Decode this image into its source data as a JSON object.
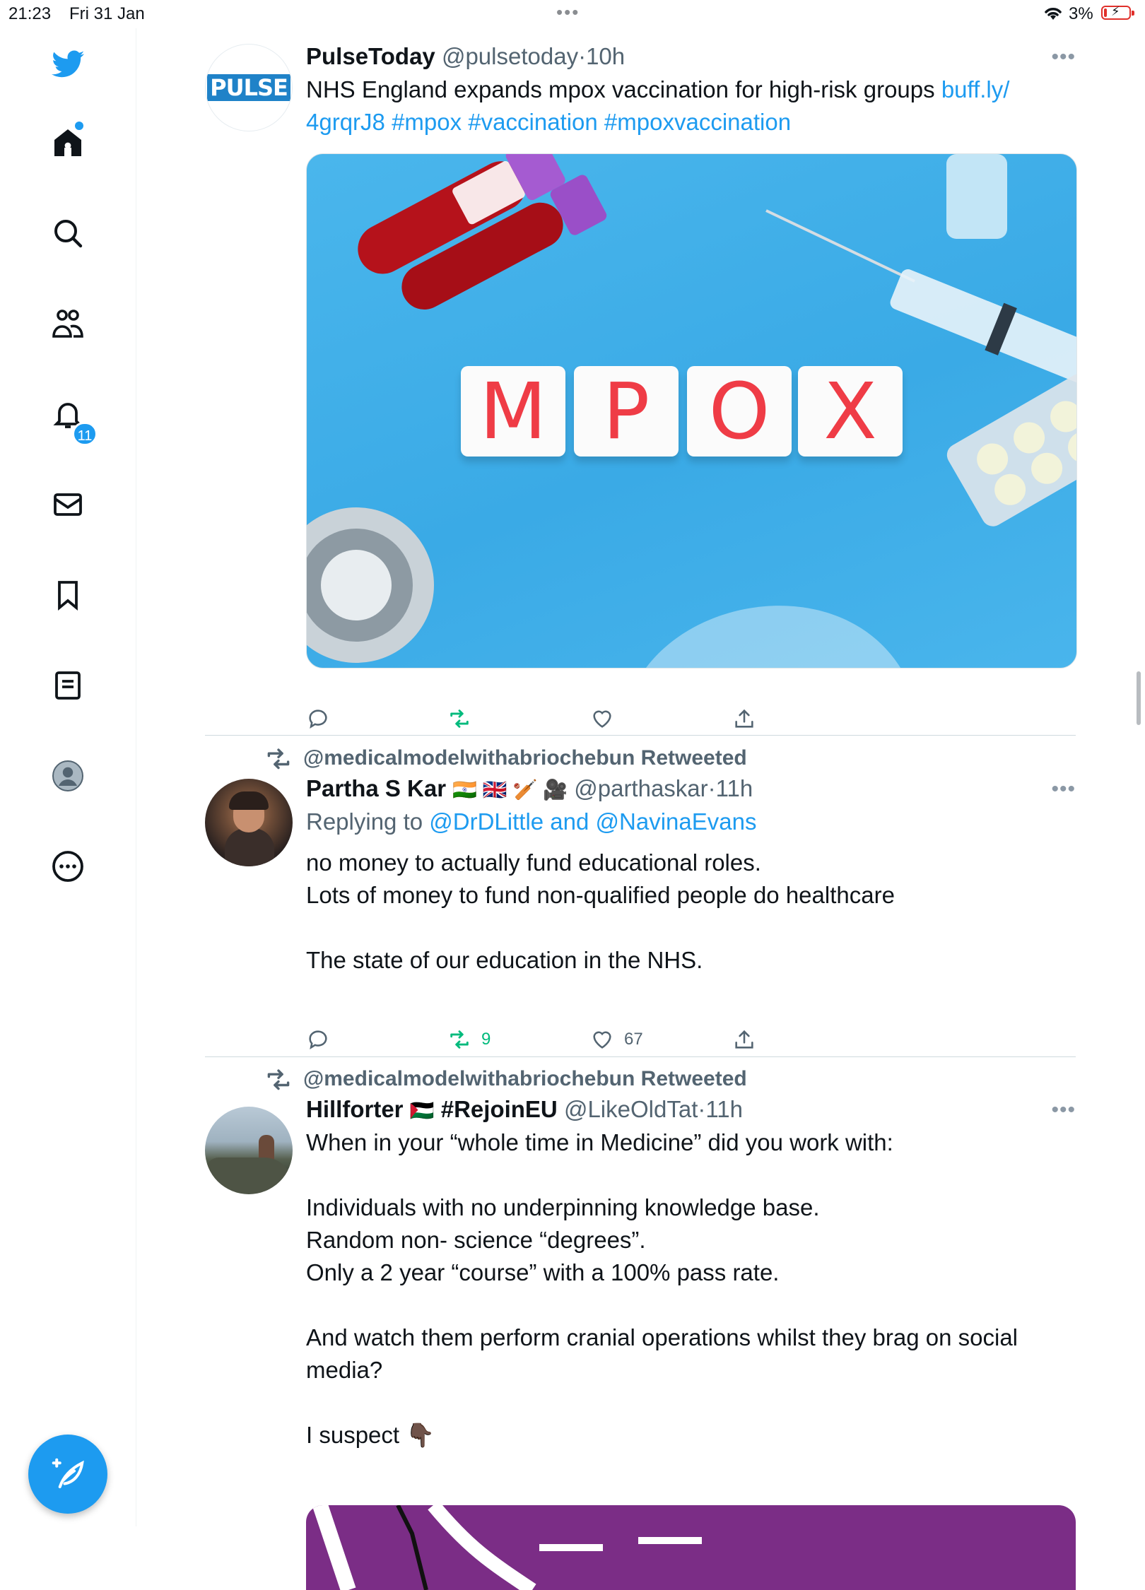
{
  "status_bar": {
    "time": "21:23",
    "date": "Fri 31 Jan",
    "battery": "3%"
  },
  "sidebar": {
    "items": [
      "twitter-logo",
      "home",
      "explore",
      "communities",
      "notifications",
      "messages",
      "bookmarks",
      "lists",
      "profile",
      "more"
    ],
    "notification_count": "11"
  },
  "tweets": [
    {
      "name": "PulseToday",
      "handle": "@pulsetoday",
      "sep": "·",
      "time": "10h",
      "avatar_text": "PULSE",
      "text": "NHS England expands mpox vaccination for high-risk groups ",
      "link_1": "buff.ly/",
      "link_2": "4grqrJ8",
      "hashtags": [
        "#mpox",
        "#vaccination",
        "#mpoxvaccination"
      ],
      "media_tiles": [
        "M",
        "P",
        "O",
        "X"
      ]
    },
    {
      "retweeted_by": "@medicalmodelwithabriochebun Retweeted",
      "name": "Partha S Kar",
      "name_emoji": "🇮🇳 🇬🇧 🏏 🎥",
      "handle": "@parthaskar",
      "sep": "·",
      "time": "11h",
      "replying_prefix": "Replying to ",
      "replying_to": "@DrDLittle and @NavinaEvans",
      "lines": [
        "no money to actually fund educational roles.",
        "Lots of money to fund non-qualified people do healthcare",
        "The state of our education in the NHS."
      ],
      "retweets": "9",
      "likes": "67"
    },
    {
      "retweeted_by": "@medicalmodelwithabriochebun Retweeted",
      "name": "Hillforter",
      "name_suffix": "#RejoinEU",
      "name_flag": "🇵🇸",
      "handle": "@LikeOldTat",
      "sep": "·",
      "time": "11h",
      "lines": [
        "When in your “whole time in Medicine” did you work with:",
        "Individuals with no underpinning knowledge base.",
        "Random non- science “degrees”.",
        "Only a 2 year “course” with a 100% pass rate.",
        "And watch them perform cranial operations whilst they brag on social",
        "media?",
        "I suspect 👇🏿"
      ]
    }
  ],
  "colors": {
    "accent": "#1d9bf0",
    "retweet_green": "#00ba7c",
    "muted": "#536471"
  }
}
